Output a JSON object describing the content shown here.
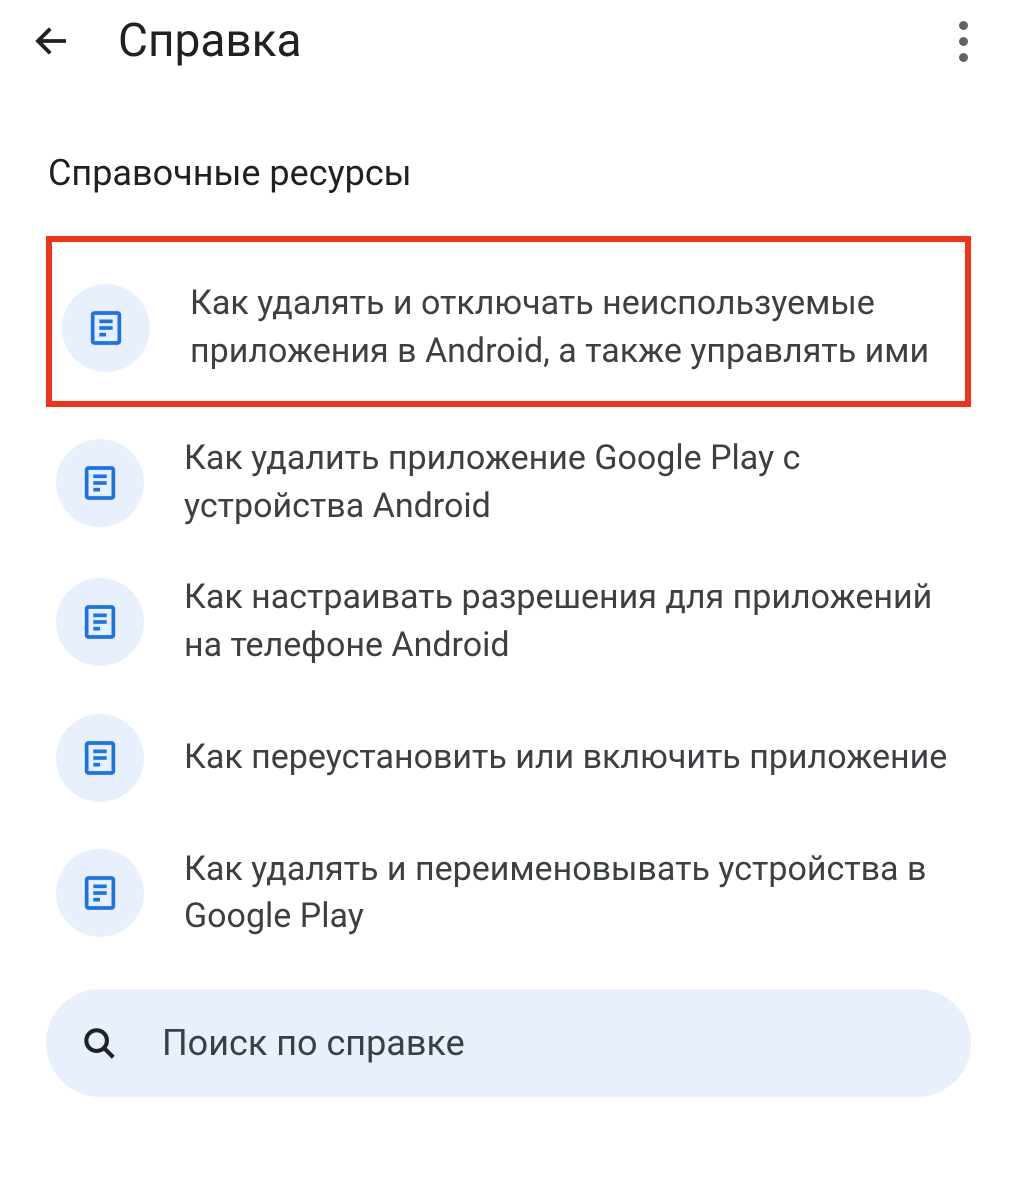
{
  "header": {
    "title": "Справка"
  },
  "section_title": "Справочные ресурсы",
  "items": [
    {
      "label": "Как удалять и отключать неиспользуемые приложения в Android, a также управлять ими",
      "highlighted": true
    },
    {
      "label": "Как удалить приложение Google Play c устройства Android",
      "highlighted": false
    },
    {
      "label": "Как настраивать разрешения для приложений на телефоне Android",
      "highlighted": false
    },
    {
      "label": "Как переустановить или включить приложение",
      "highlighted": false
    },
    {
      "label": "Как удалять и переименовывать устройства в Google Play",
      "highlighted": false
    }
  ],
  "search": {
    "placeholder": "Поиск по справке"
  }
}
